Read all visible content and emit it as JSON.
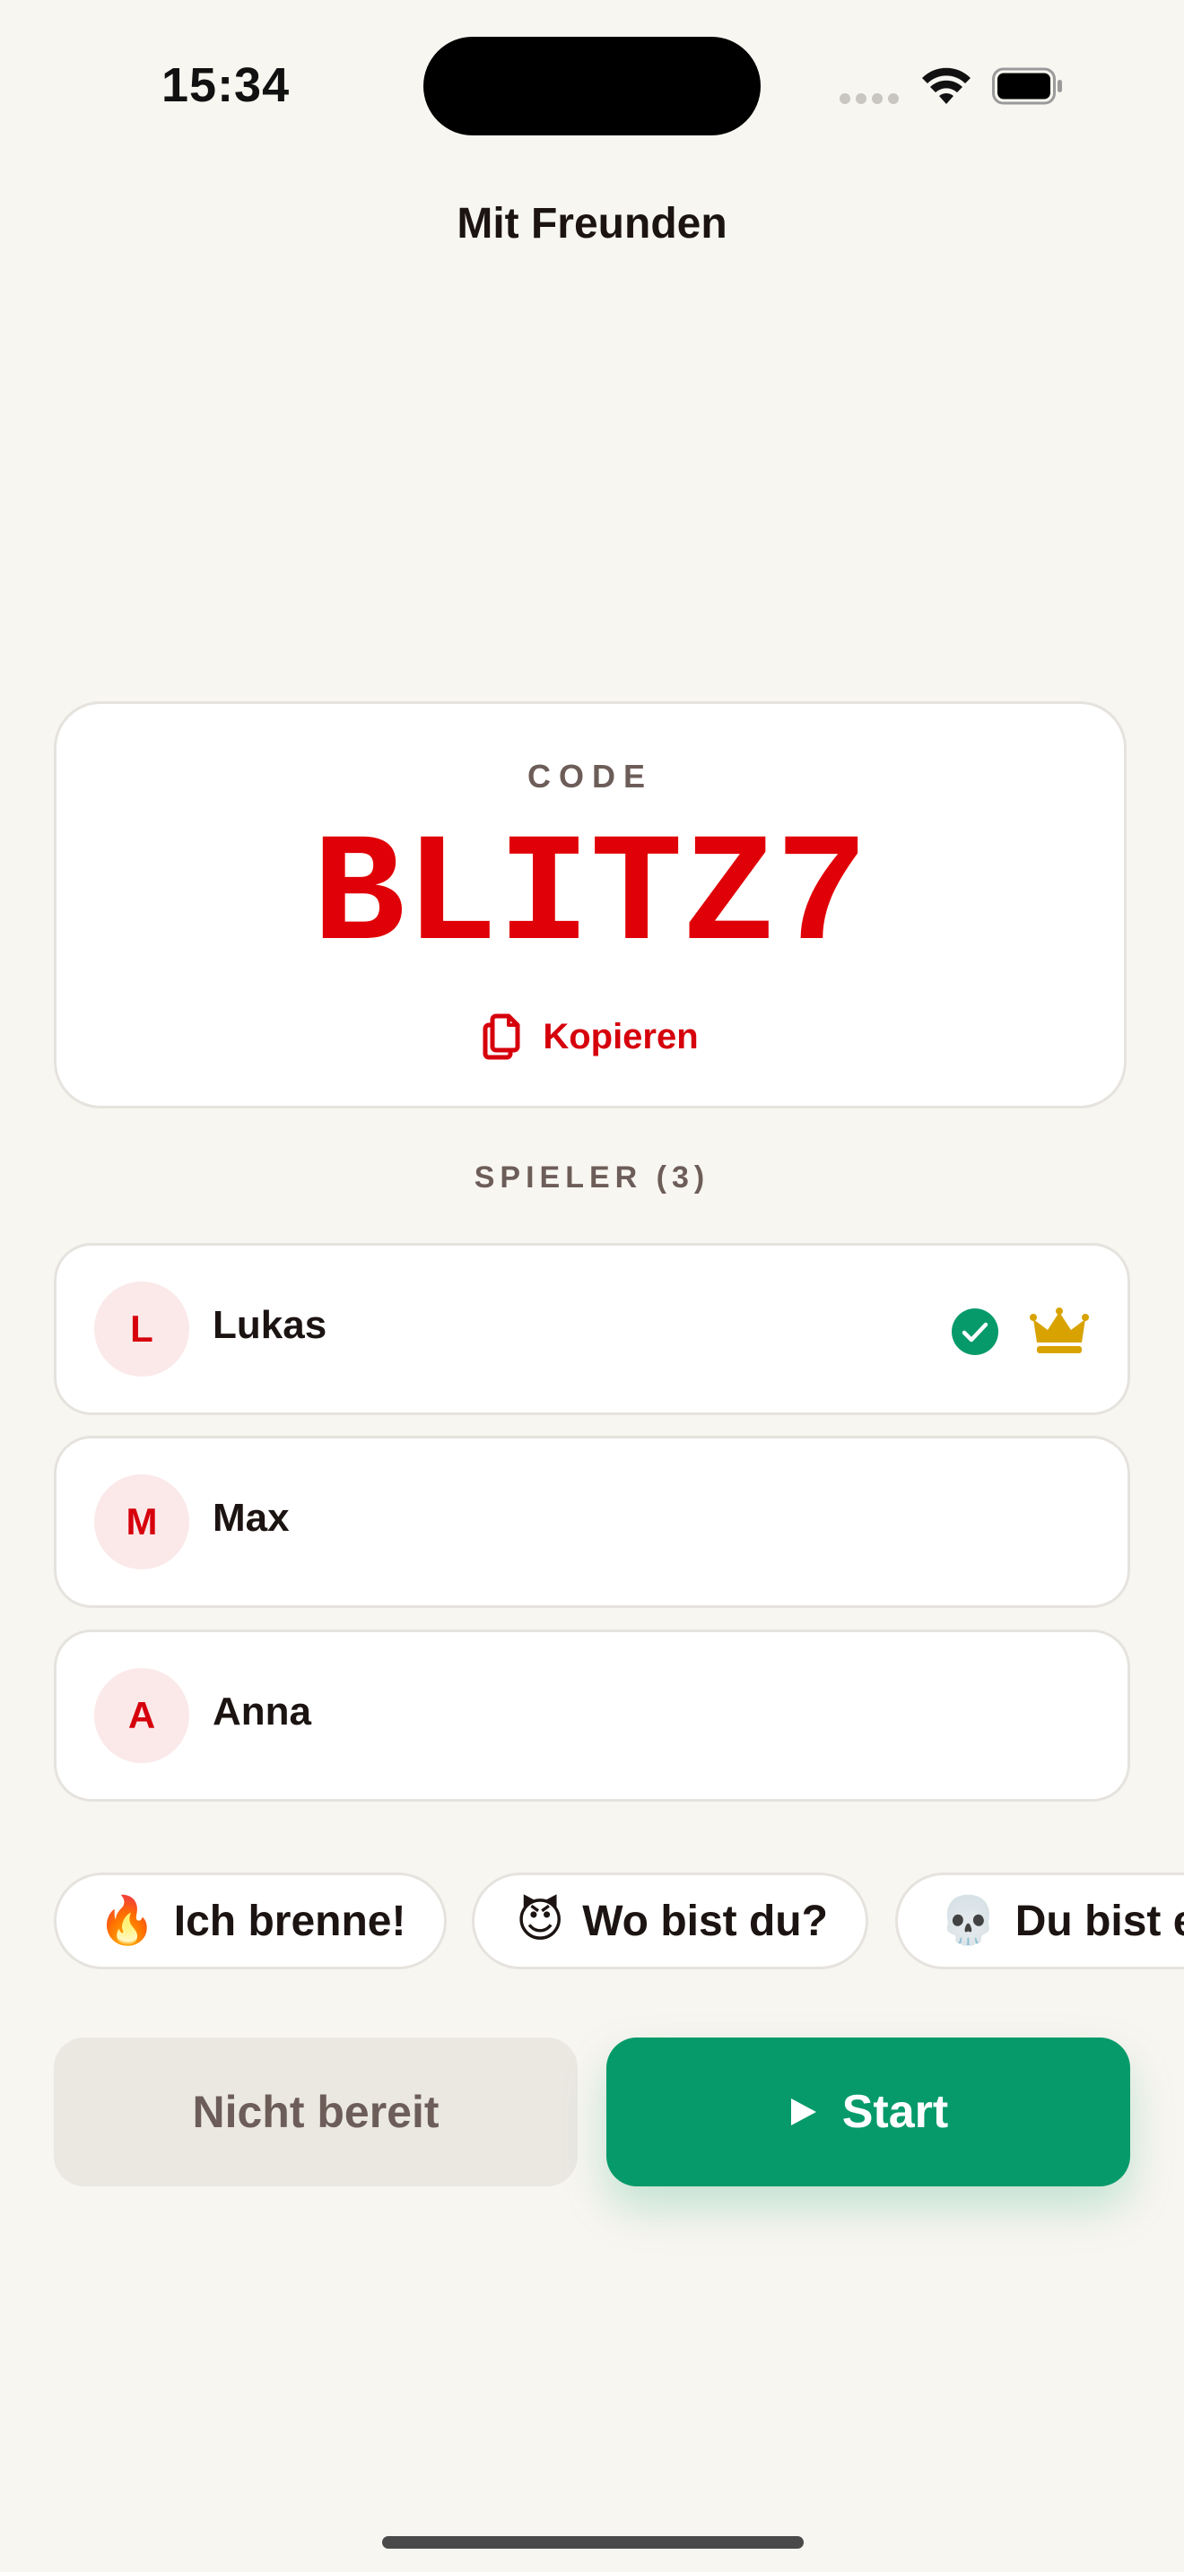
{
  "status_bar": {
    "time": "15:34"
  },
  "nav": {
    "title": "Mit Freunden"
  },
  "code_card": {
    "label": "CODE",
    "code": "BLITZ7",
    "copy_label": "Kopieren"
  },
  "players": {
    "header": "SPIELER (3)",
    "items": [
      {
        "initial": "L",
        "name": "Lukas",
        "ready": true,
        "host": true
      },
      {
        "initial": "M",
        "name": "Max",
        "ready": false,
        "host": false
      },
      {
        "initial": "A",
        "name": "Anna",
        "ready": false,
        "host": false
      }
    ]
  },
  "reactions": [
    {
      "emoji": "🔥",
      "label": "Ich brenne!"
    },
    {
      "emoji": "😈",
      "label": "Wo bist du?"
    },
    {
      "emoji": "💀",
      "label": "Du bist e"
    }
  ],
  "actions": {
    "not_ready_label": "Nicht bereit",
    "start_label": "Start"
  },
  "colors": {
    "accent_red": "#e00007",
    "start_green": "#069a6b",
    "background": "#f8f6f0"
  }
}
